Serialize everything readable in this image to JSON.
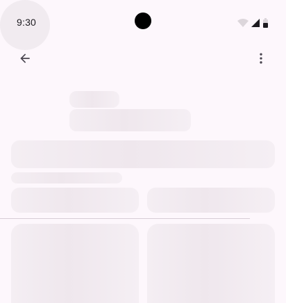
{
  "status_bar": {
    "time": "9:30",
    "icons": [
      "wifi-icon",
      "cellular-signal-icon",
      "battery-icon"
    ]
  },
  "app_bar": {
    "navigation_icon": "arrow-back-icon",
    "overflow_icon": "more-vert-icon"
  },
  "colors": {
    "background": "#fdf7fc",
    "skeleton": "#f1ebf0",
    "icon": "#49454f",
    "divider": "#d7ccd6"
  }
}
